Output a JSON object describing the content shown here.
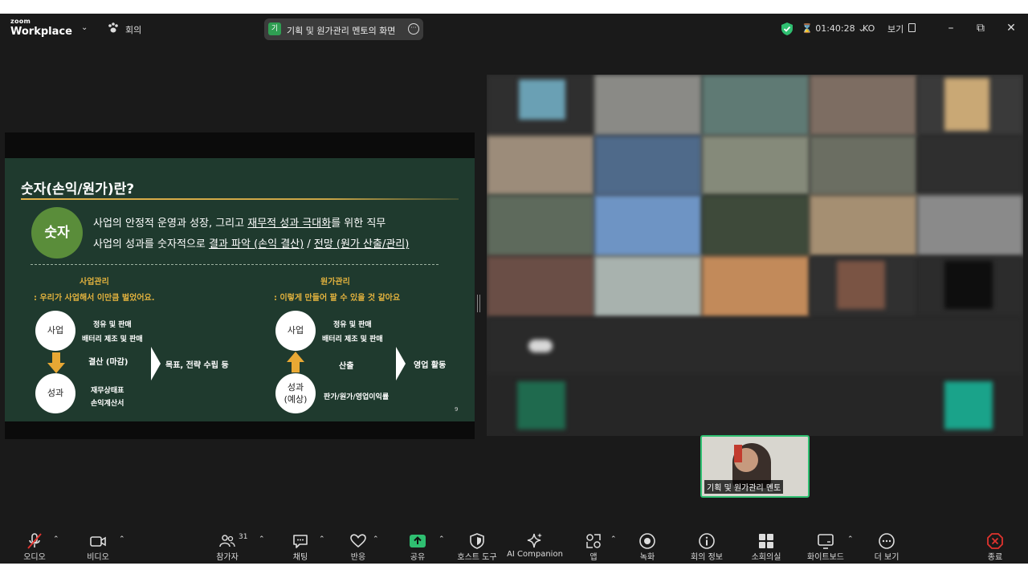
{
  "titlebar": {
    "brand_top": "zoom",
    "brand_main": "Workplace",
    "meeting_label": "회의",
    "share_avatar": "기",
    "share_text": "기획 및 원가관리 멘토의 화면",
    "timer": "01:40:28",
    "language": "KO",
    "view_label": "보기"
  },
  "slide": {
    "title": "숫자(손익/원가)란?",
    "badge": "숫자",
    "line1_pre": "사업의 안정적 운영과 성장, 그리고 ",
    "line1_u": "재무적 성과 극대화",
    "line1_post": "를 위한 직무",
    "line2_pre": "사업의 성과를 숫자적으로 ",
    "line2_u1": "결과 파악 (손익 결산)",
    "line2_mid": " / ",
    "line2_u2": "전망 (원가 산출/관리)",
    "left": {
      "heading": "사업관리",
      "subheading": ": 우리가 사업해서 이만큼 벌었어요.",
      "top_circle": "사업",
      "top_note1": "정유 및 판매",
      "top_note2": "배터리 제조 및 판매",
      "middle": "결산 (마감)",
      "result": "목표, 전략 수립 등",
      "bottom_circle": "성과",
      "bottom_note1": "재무상태표",
      "bottom_note2": "손익계산서"
    },
    "right": {
      "heading": "원가관리",
      "subheading": ": 이렇게 만들어 팔 수 있을 것 같아요",
      "top_circle": "사업",
      "top_note1": "정유 및 판매",
      "top_note2": "배터리 제조 및 판매",
      "middle": "산출",
      "result": "영업 활동",
      "bottom_circle_1": "성과",
      "bottom_circle_2": "(예상)",
      "bottom_note": "판가/원가/영업이익률"
    },
    "page": "9"
  },
  "selfview": {
    "name": "기획 및 원가관리 멘토"
  },
  "toolbar": {
    "audio": "오디오",
    "video": "비디오",
    "participants": "참가자",
    "participant_count": "31",
    "chat": "채팅",
    "reactions": "반응",
    "share": "공유",
    "host_tools": "호스트 도구",
    "ai_companion": "AI Companion",
    "apps": "앱",
    "record": "녹화",
    "meeting_info": "회의 정보",
    "breakout": "소회의실",
    "whiteboard": "화이트보드",
    "more": "더 보기",
    "end": "종료"
  },
  "colors": {
    "background": "#1a1a1a",
    "slide_green": "#1f3a2e",
    "accent_gold": "#e2b23e",
    "badge_green": "#5a8d3a",
    "share_green": "#2fbf71",
    "end_red": "#e0332e"
  }
}
